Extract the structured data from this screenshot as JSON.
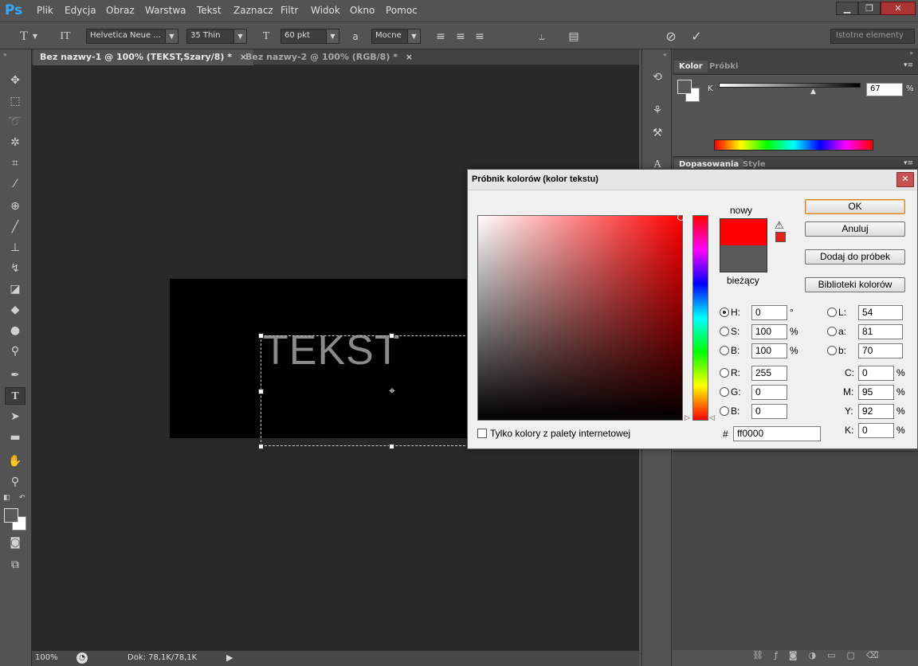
{
  "app": {
    "logo": "Ps",
    "menu": [
      "Plik",
      "Edycja",
      "Obraz",
      "Warstwa",
      "Tekst",
      "Zaznacz",
      "Filtr",
      "Widok",
      "Okno",
      "Pomoc"
    ],
    "window_controls": {
      "minimize": "▁",
      "restore": "❐",
      "close": "✕"
    }
  },
  "options": {
    "font_family": "Helvetica Neue ...",
    "font_style": "35 Thin",
    "font_size": "60 pkt",
    "antialias_label": "a",
    "antialias": "Mocne",
    "workspace": "Istotne elementy"
  },
  "tabs": [
    {
      "label": "Bez nazwy-1 @ 100% (TEKST,Szary/8) *",
      "close": "×"
    },
    {
      "label": "Bez nazwy-2 @ 100% (RGB/8) *",
      "close": "×"
    }
  ],
  "canvas": {
    "text": "TEKST"
  },
  "status": {
    "zoom": "100%",
    "doc": "Dok: 78,1K/78,1K"
  },
  "panels": {
    "color_tabs": [
      "Kolor",
      "Próbki"
    ],
    "k_label": "K",
    "k_value": "67",
    "k_unit": "%",
    "adjust_tabs": [
      "Dopasowania",
      "Style"
    ]
  },
  "dialog": {
    "title": "Próbnik kolorów (kolor tekstu)",
    "close": "✕",
    "new_label": "nowy",
    "current_label": "bieżący",
    "new_color": "#ff0000",
    "current_color": "#595959",
    "buttons": {
      "ok": "OK",
      "cancel": "Anuluj",
      "add_swatches": "Dodaj do próbek",
      "libraries": "Biblioteki kolorów"
    },
    "hsb": {
      "h": {
        "label": "H:",
        "value": "0",
        "unit": "°"
      },
      "s": {
        "label": "S:",
        "value": "100",
        "unit": "%"
      },
      "b": {
        "label": "B:",
        "value": "100",
        "unit": "%"
      }
    },
    "rgb": {
      "r": {
        "label": "R:",
        "value": "255"
      },
      "g": {
        "label": "G:",
        "value": "0"
      },
      "b": {
        "label": "B:",
        "value": "0"
      }
    },
    "lab": {
      "l": {
        "label": "L:",
        "value": "54"
      },
      "a": {
        "label": "a:",
        "value": "81"
      },
      "b": {
        "label": "b:",
        "value": "70"
      }
    },
    "cmyk": {
      "c": {
        "label": "C:",
        "value": "0",
        "unit": "%"
      },
      "m": {
        "label": "M:",
        "value": "95",
        "unit": "%"
      },
      "y": {
        "label": "Y:",
        "value": "92",
        "unit": "%"
      },
      "k": {
        "label": "K:",
        "value": "0",
        "unit": "%"
      }
    },
    "hex_label": "#",
    "hex": "ff0000",
    "web_only": "Tylko kolory z palety internetowej"
  },
  "colors": {
    "app_bg": "#535353",
    "canvas_bg": "#282828",
    "ps_blue": "#33aaff",
    "accent_orange": "#d9822b"
  }
}
